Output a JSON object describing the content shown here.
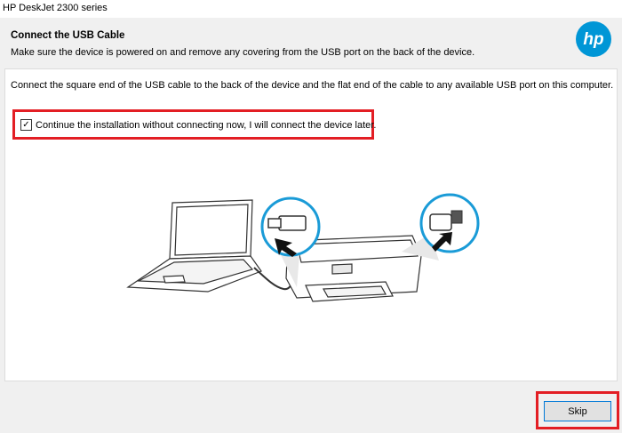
{
  "window": {
    "title": "HP DeskJet 2300 series"
  },
  "header": {
    "title": "Connect the USB Cable",
    "subtitle": "Make sure the device is powered on and remove any covering from the USB port on the back of the device.",
    "logo_text": "hp",
    "logo_color": "#0096d6"
  },
  "main": {
    "instructions": "Connect the square end of the USB cable to the back of the device and the flat end of the cable to any available USB port on this computer.",
    "checkbox": {
      "label": "Continue the installation without connecting now, I will connect the device later.",
      "checked": true
    }
  },
  "footer": {
    "skip_label": "Skip"
  },
  "colors": {
    "highlight": "#e31e24",
    "callout": "#1a9bd7"
  }
}
